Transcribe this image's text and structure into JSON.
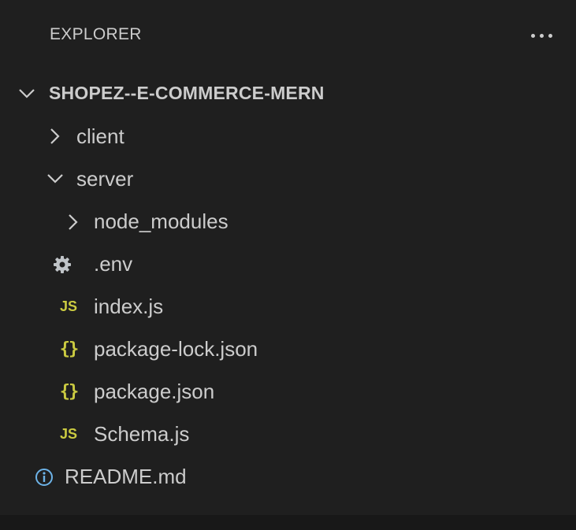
{
  "header": {
    "title": "EXPLORER",
    "more_actions_icon": "ellipsis-icon"
  },
  "tree": {
    "root": {
      "label": "SHOPEZ--E-COMMERCE-MERN",
      "expanded": true
    },
    "items": [
      {
        "label": "client",
        "type": "folder",
        "expanded": false,
        "depth": 1
      },
      {
        "label": "server",
        "type": "folder",
        "expanded": true,
        "depth": 1
      },
      {
        "label": "node_modules",
        "type": "folder",
        "expanded": false,
        "depth": 2
      },
      {
        "label": ".env",
        "type": "file",
        "icon": "gear-icon",
        "depth": 2
      },
      {
        "label": "index.js",
        "type": "file",
        "icon": "js-icon",
        "depth": 2
      },
      {
        "label": "package-lock.json",
        "type": "file",
        "icon": "json-icon",
        "depth": 2
      },
      {
        "label": "package.json",
        "type": "file",
        "icon": "json-icon",
        "depth": 2
      },
      {
        "label": "Schema.js",
        "type": "file",
        "icon": "js-icon",
        "depth": 2
      },
      {
        "label": "README.md",
        "type": "file",
        "icon": "info-icon",
        "depth": 1
      }
    ]
  },
  "icons": {
    "js_text": "JS",
    "json_text": "{}"
  },
  "colors": {
    "background": "#1f1f1f",
    "text": "#cccccc",
    "js_yellow": "#cbcb41",
    "gear_gray": "#c0c4c8",
    "info_blue": "#6db3e8"
  }
}
